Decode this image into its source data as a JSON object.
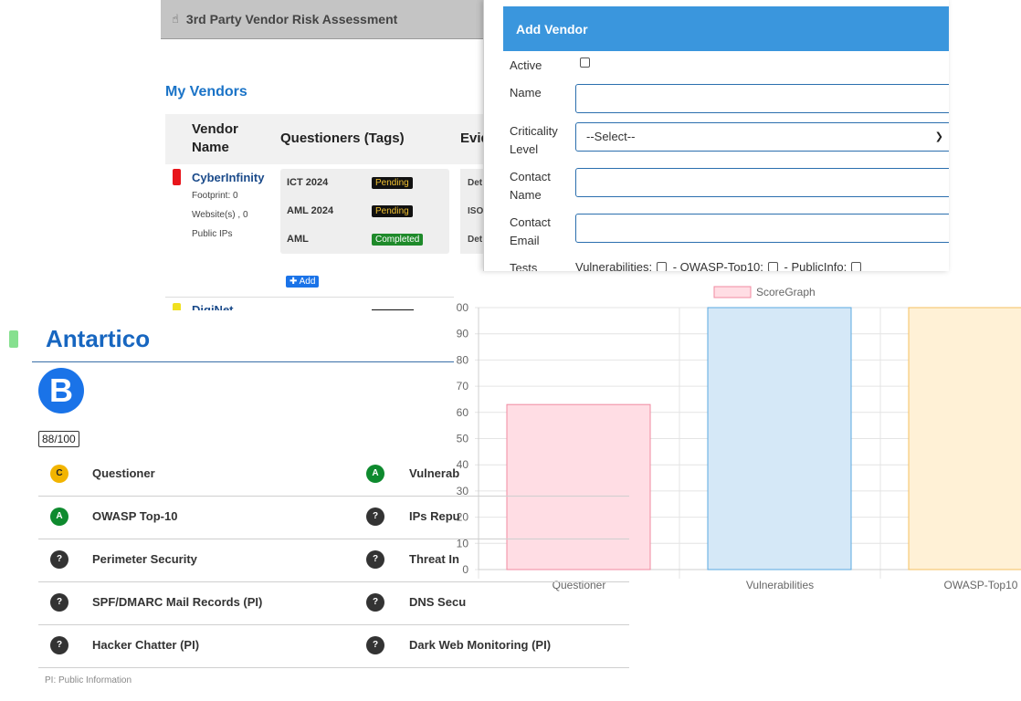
{
  "app": {
    "title": "3rd Party Vendor Risk Assessment",
    "section_title": "My Vendors"
  },
  "vendor_table": {
    "headers": [
      "Vendor Name",
      "Questioners (Tags)",
      "Evid"
    ],
    "rows": [
      {
        "name": "CyberInfinity",
        "meta": [
          "Footprint: 0",
          "Website(s) , 0",
          "Public IPs"
        ],
        "questioners": [
          {
            "label": "ICT 2024",
            "status": "Pending"
          },
          {
            "label": "AML 2024",
            "status": "Pending"
          },
          {
            "label": "AML",
            "status": "Completed"
          }
        ],
        "evidence": [
          "Det",
          "ISO",
          "Det"
        ],
        "add_label": "✚ Add"
      }
    ],
    "partial_row_name": "DigiNet"
  },
  "modal": {
    "title": "Add Vendor",
    "labels": {
      "active": "Active",
      "name": "Name",
      "criticality": "Criticality Level",
      "contact_name": "Contact Name",
      "contact_email": "Contact Email",
      "tests": "Tests"
    },
    "criticality_value": "--Select--",
    "tests_options": [
      "Vulnerabilities:",
      "- OWASP-Top10:",
      "- PublicInfo:"
    ]
  },
  "scorecard": {
    "vendor": "Antartico",
    "grade": "B",
    "score": "88/100",
    "footnote": "PI: Public Information",
    "items_left": [
      {
        "grade": "C",
        "label": "Questioner"
      },
      {
        "grade": "A",
        "label": "OWASP Top-10"
      },
      {
        "grade": "?",
        "label": "Perimeter Security"
      },
      {
        "grade": "?",
        "label": "SPF/DMARC Mail Records (PI)"
      },
      {
        "grade": "?",
        "label": "Hacker Chatter (PI)"
      }
    ],
    "items_right": [
      {
        "grade": "A",
        "label": "Vulnerab"
      },
      {
        "grade": "?",
        "label": "IPs Repu"
      },
      {
        "grade": "?",
        "label": "Threat In"
      },
      {
        "grade": "?",
        "label": "DNS Secu"
      },
      {
        "grade": "?",
        "label": "Dark Web Monitoring (PI)"
      }
    ]
  },
  "chart_data": {
    "type": "bar",
    "categories": [
      "Questioner",
      "Vulnerabilities",
      "OWASP-Top10"
    ],
    "series": [
      {
        "name": "ScoreGraph",
        "values": [
          63,
          100,
          100
        ]
      }
    ],
    "bar_colors": [
      "#ffdde4",
      "#d5e8f7",
      "#fff1d6"
    ],
    "bar_borders": [
      "#f08aa0",
      "#5aa9e0",
      "#f5c060"
    ],
    "yticks": [
      "00",
      "90",
      "80",
      "70",
      "60",
      "50",
      "40",
      "30",
      "20",
      "10",
      "0"
    ],
    "ylim": [
      0,
      100
    ],
    "legend": "top"
  }
}
